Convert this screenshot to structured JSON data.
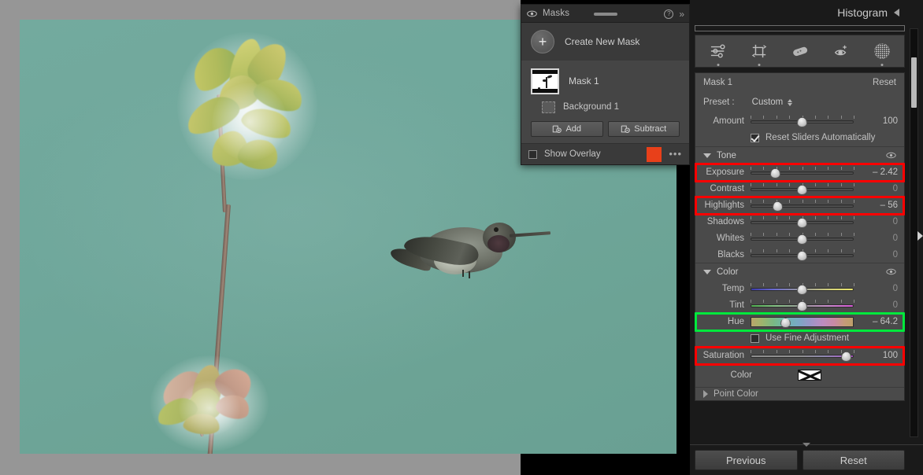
{
  "masks_panel": {
    "title": "Masks",
    "eye_icon": "eye-icon",
    "help_icon": "help-circle-icon",
    "collapse_icon": "double-chevron-right-icon",
    "create_new_mask": "Create New Mask",
    "plus_label": "+",
    "mask_item": {
      "name": "Mask 1",
      "thumbnail": "mask-thumbnail"
    },
    "background_item": {
      "name": "Background 1",
      "icon": "background-layer-icon"
    },
    "add_button": "Add",
    "subtract_button": "Subtract",
    "add_icon": "add-mask-icon",
    "subtract_icon": "subtract-mask-icon",
    "show_overlay": "Show Overlay",
    "overlay_checked": false,
    "overlay_color": "#e8401a",
    "more_options": "•••"
  },
  "right_panel": {
    "histogram_title": "Histogram",
    "collapse_icon": "triangle-left-icon",
    "tools": [
      {
        "name": "edit-sliders-icon",
        "active_dot": true
      },
      {
        "name": "crop-rotate-icon",
        "active_dot": true
      },
      {
        "name": "healing-brush-icon",
        "active_dot": false
      },
      {
        "name": "red-eye-icon",
        "active_dot": false
      },
      {
        "name": "masking-icon",
        "active_dot": true
      }
    ],
    "mask_header": {
      "title": "Mask 1",
      "reset_label": "Reset"
    },
    "preset": {
      "label": "Preset :",
      "value": "Custom"
    },
    "amount": {
      "label": "Amount",
      "value": "100",
      "knob_pct": 50
    },
    "reset_sliders": {
      "label": "Reset Sliders Automatically",
      "checked": true
    },
    "tone_section": {
      "name": "Tone",
      "eye_icon": "eye-icon",
      "sliders": [
        {
          "label": "Exposure",
          "value": "– 2.42",
          "knob_pct": 24,
          "dim": false,
          "highlight": "red",
          "gradient": ""
        },
        {
          "label": "Contrast",
          "value": "0",
          "knob_pct": 50,
          "dim": true,
          "highlight": "",
          "gradient": ""
        },
        {
          "label": "Highlights",
          "value": "– 56",
          "knob_pct": 26,
          "dim": false,
          "highlight": "red",
          "gradient": ""
        },
        {
          "label": "Shadows",
          "value": "0",
          "knob_pct": 50,
          "dim": true,
          "highlight": "",
          "gradient": ""
        },
        {
          "label": "Whites",
          "value": "0",
          "knob_pct": 50,
          "dim": true,
          "highlight": "",
          "gradient": ""
        },
        {
          "label": "Blacks",
          "value": "0",
          "knob_pct": 50,
          "dim": true,
          "highlight": "",
          "gradient": ""
        }
      ]
    },
    "color_section": {
      "name": "Color",
      "eye_icon": "eye-icon",
      "sliders": [
        {
          "label": "Temp",
          "value": "0",
          "knob_pct": 50,
          "dim": true,
          "highlight": "",
          "gradient": "grad-temp"
        },
        {
          "label": "Tint",
          "value": "0",
          "knob_pct": 50,
          "dim": true,
          "highlight": "",
          "gradient": "grad-tint"
        },
        {
          "label": "Hue",
          "value": "– 64.2",
          "knob_pct": 34,
          "dim": false,
          "highlight": "green",
          "gradient": "grad-hue"
        },
        {
          "label": "Saturation",
          "value": "100",
          "knob_pct": 93,
          "dim": false,
          "highlight": "red",
          "gradient": "grad-sat"
        }
      ],
      "fine_adjust": {
        "label": "Use Fine Adjustment",
        "checked": false
      },
      "color_row": {
        "label": "Color",
        "swatch": "no-color-swatch"
      }
    },
    "point_color_section": {
      "name": "Point Color"
    },
    "previous_button": "Previous",
    "reset_button": "Reset"
  },
  "photo": {
    "subject": "hummingbird-on-branch",
    "background_color": "#6fa79b",
    "backdrop_color": "#969696"
  }
}
